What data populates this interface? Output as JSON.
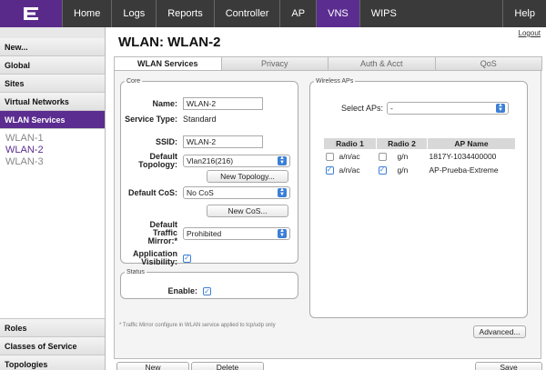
{
  "nav": {
    "tabs": [
      "Home",
      "Logs",
      "Reports",
      "Controller",
      "AP",
      "VNS",
      "WIPS"
    ],
    "active": "VNS",
    "help": "Help",
    "logout": "Logout"
  },
  "sidebar": {
    "items_top": [
      "New...",
      "Global",
      "Sites",
      "Virtual Networks",
      "WLAN Services"
    ],
    "active": "WLAN Services",
    "wlans": [
      "WLAN-1",
      "WLAN-2",
      "WLAN-3"
    ],
    "selected_wlan": "WLAN-2",
    "items_bottom": [
      "Roles",
      "Classes of Service",
      "Topologies"
    ]
  },
  "page": {
    "title": "WLAN: WLAN-2"
  },
  "tabs": [
    "WLAN Services",
    "Privacy",
    "Auth & Acct",
    "QoS"
  ],
  "core": {
    "legend": "Core",
    "name_label": "Name:",
    "name_value": "WLAN-2",
    "service_type_label": "Service Type:",
    "service_type_value": "Standard",
    "ssid_label": "SSID:",
    "ssid_value": "WLAN-2",
    "topology_label": "Default Topology:",
    "topology_value": "Vlan216(216)",
    "new_topology_btn": "New Topology...",
    "cos_label": "Default CoS:",
    "cos_value": "No CoS",
    "new_cos_btn": "New CoS...",
    "mirror_label": "Default Traffic Mirror:*",
    "mirror_value": "Prohibited",
    "app_vis_label": "Application Visibility:"
  },
  "status": {
    "legend": "Status",
    "enable_label": "Enable:"
  },
  "wireless": {
    "legend": "Wireless APs",
    "select_label": "Select APs:",
    "select_value": "-",
    "headers": [
      "Radio 1",
      "Radio 2",
      "AP Name"
    ],
    "rows": [
      {
        "r1": "a/n/ac",
        "r1_checked": false,
        "r2": "g/n",
        "r2_checked": false,
        "name": "1817Y-1034400000"
      },
      {
        "r1": "a/n/ac",
        "r1_checked": true,
        "r2": "g/n",
        "r2_checked": true,
        "name": "AP-Prueba-Extreme"
      }
    ]
  },
  "footnote": "* Traffic Mirror configure in WLAN service applied to tcp/udp only",
  "advanced_btn": "Advanced...",
  "bottom": {
    "new": "New",
    "delete": "Delete",
    "save": "Save"
  },
  "colors": {
    "accent": "#5b2d90",
    "checkbox": "#3c7fd8"
  }
}
